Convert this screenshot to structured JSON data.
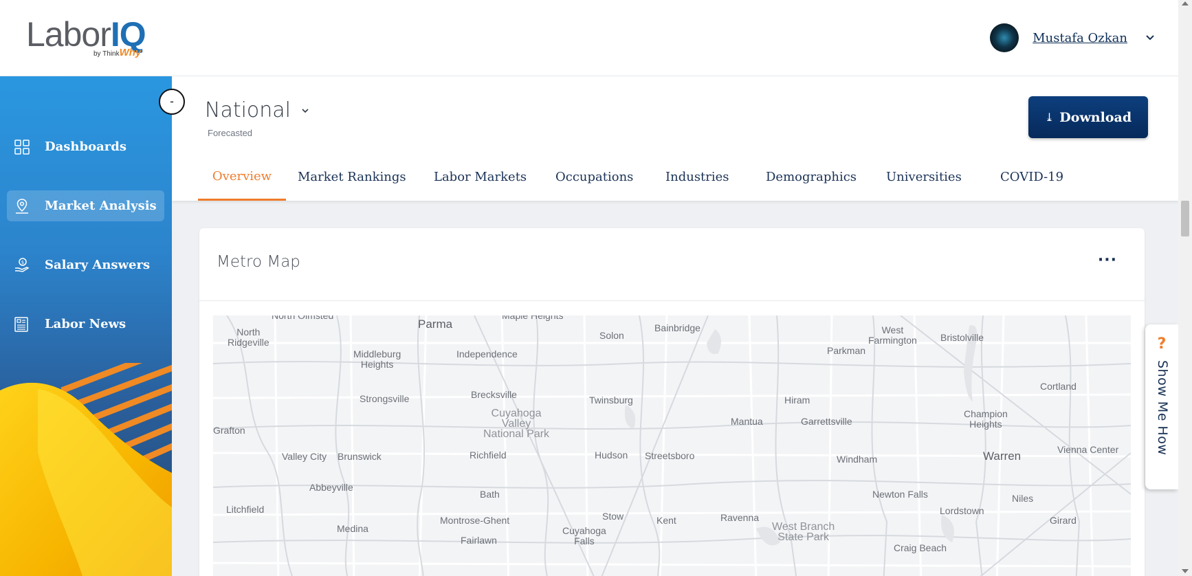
{
  "logo": {
    "brand_left": "Labor",
    "brand_right": "IQ",
    "byline": "by Think",
    "byline_accent": "Why"
  },
  "user": {
    "name": "Mustafa Ozkan",
    "menu_icon": "chevron-down-icon"
  },
  "sidebar": {
    "collapse_label": "-",
    "items": [
      {
        "label": "Dashboards",
        "icon": "dashboard-grid-icon",
        "active": false
      },
      {
        "label": "Market Analysis",
        "icon": "map-pin-icon",
        "active": true
      },
      {
        "label": "Salary Answers",
        "icon": "money-hand-icon",
        "active": false
      },
      {
        "label": "Labor News",
        "icon": "newspaper-icon",
        "active": false
      }
    ]
  },
  "header": {
    "region": "National",
    "region_subtitle": "Forecasted",
    "download_icon": "⤓",
    "download_label": "Download"
  },
  "tabs": [
    {
      "label": "Overview",
      "active": true
    },
    {
      "label": "Market Rankings",
      "active": false
    },
    {
      "label": "Labor Markets",
      "active": false
    },
    {
      "label": "Occupations",
      "active": false
    },
    {
      "label": "Industries",
      "active": false
    },
    {
      "label": "Demographics",
      "active": false
    },
    {
      "label": "Universities",
      "active": false
    },
    {
      "label": "COVID-19",
      "active": false
    }
  ],
  "card": {
    "title": "Metro Map",
    "more_label": "···"
  },
  "map_labels": [
    "North Olmsted",
    "Parma",
    "Maple Heights",
    "North\nRidgeville",
    "Solon",
    "Bainbridge",
    "West\nFarmington",
    "Bristolville",
    "Parkman",
    "Middleburg\nHeights",
    "Independence",
    "Strongsville",
    "Brecksville",
    "Twinsburg",
    "Hiram",
    "Cortland",
    "Cuyahoga\nValley\nNational Park",
    "Mantua",
    "Garrettsville",
    "Champion\nHeights",
    "Grafton",
    "Valley City",
    "Brunswick",
    "Richfield",
    "Hudson",
    "Streetsboro",
    "Windham",
    "Warren",
    "Vienna Center",
    "Abbeyville",
    "Bath",
    "Newton Falls",
    "Niles",
    "Litchfield",
    "Stow",
    "Ravenna",
    "Lordstown",
    "Montrose-Ghent",
    "Kent",
    "Girard",
    "Medina",
    "Cuyahoga\nFalls",
    "Fairlawn",
    "West Branch\nState Park",
    "Craig Beach"
  ],
  "show_me_how": {
    "icon": "?",
    "label": "Show Me How"
  },
  "colors": {
    "accent": "#ef7c2c",
    "navy": "#0d2e57",
    "sidebar_top": "#2a97e0",
    "sidebar_bottom": "#24476f"
  }
}
